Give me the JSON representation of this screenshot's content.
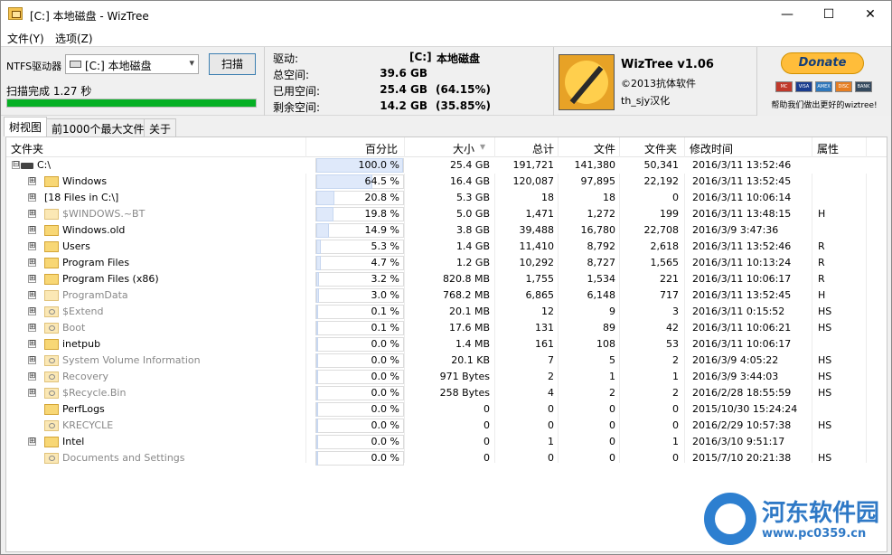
{
  "window": {
    "title": "[C:] 本地磁盘  - WizTree",
    "minimize": "—",
    "maximize": "☐",
    "close": "✕"
  },
  "menu": [
    "文件(Y)",
    "选项(Z)"
  ],
  "scan": {
    "drive_label": "NTFS驱动器",
    "drive_value": "[C:] 本地磁盘",
    "scan_button": "扫描",
    "status": "扫描完成 1.27 秒",
    "progress_percent": 100,
    "progress_color": "#06b025"
  },
  "drive_info": {
    "drive_label": "驱动:",
    "drive_letter": "[C:]",
    "drive_name": "本地磁盘",
    "total_label": "总空间:",
    "total_value": "39.6 GB",
    "used_label": "已用空间:",
    "used_value": "25.4 GB",
    "used_pct": "(64.15%)",
    "free_label": "剩余空间:",
    "free_value": "14.2 GB",
    "free_pct": "(35.85%)"
  },
  "about": {
    "name": "WizTree v1.06",
    "copyright": "©2013抗体软件",
    "translator": "th_sjy汉化",
    "donate": "Donate",
    "help_text": "帮助我们做出更好的wiztree!",
    "cards": [
      "MC",
      "VISA",
      "AMEX",
      "DISC",
      "BANK"
    ]
  },
  "tabs": [
    "树视图",
    "前1000个最大文件",
    "关于"
  ],
  "columns": [
    "文件夹",
    "百分比",
    "大小",
    "总计",
    "文件",
    "文件夹",
    "修改时间",
    "属性"
  ],
  "rows": [
    {
      "name": "C:\\",
      "pct": "100.0 %",
      "pct_value": 100.0,
      "size": "25.4 GB",
      "total": "191,721",
      "files": "141,380",
      "folders": "50,341",
      "modified": "2016/3/11 13:52:46",
      "attr": "",
      "icon": "drive-icon",
      "expander": "⊟",
      "gray": false
    },
    {
      "name": "Windows",
      "pct": "64.5 %",
      "pct_value": 64.5,
      "size": "16.4 GB",
      "total": "120,087",
      "files": "97,895",
      "folders": "22,192",
      "modified": "2016/3/11 13:52:45",
      "attr": "",
      "icon": "folder-icon",
      "expander": "⊞",
      "gray": false
    },
    {
      "name": "[18 Files in C:\\]",
      "pct": "20.8 %",
      "pct_value": 20.8,
      "size": "5.3 GB",
      "total": "18",
      "files": "18",
      "folders": "0",
      "modified": "2016/3/11 10:06:14",
      "attr": "",
      "icon": "",
      "expander": "⊞",
      "gray": false
    },
    {
      "name": "$WINDOWS.~BT",
      "pct": "19.8 %",
      "pct_value": 19.8,
      "size": "5.0 GB",
      "total": "1,471",
      "files": "1,272",
      "folders": "199",
      "modified": "2016/3/11 13:48:15",
      "attr": "H",
      "icon": "folder-icon",
      "expander": "⊞",
      "gray": true
    },
    {
      "name": "Windows.old",
      "pct": "14.9 %",
      "pct_value": 14.9,
      "size": "3.8 GB",
      "total": "39,488",
      "files": "16,780",
      "folders": "22,708",
      "modified": "2016/3/9 3:47:36",
      "attr": "",
      "icon": "folder-icon",
      "expander": "⊞",
      "gray": false
    },
    {
      "name": "Users",
      "pct": "5.3 %",
      "pct_value": 5.3,
      "size": "1.4 GB",
      "total": "11,410",
      "files": "8,792",
      "folders": "2,618",
      "modified": "2016/3/11 13:52:46",
      "attr": "R",
      "icon": "folder-icon",
      "expander": "⊞",
      "gray": false
    },
    {
      "name": "Program Files",
      "pct": "4.7 %",
      "pct_value": 4.7,
      "size": "1.2 GB",
      "total": "10,292",
      "files": "8,727",
      "folders": "1,565",
      "modified": "2016/3/11 10:13:24",
      "attr": "R",
      "icon": "folder-icon",
      "expander": "⊞",
      "gray": false
    },
    {
      "name": "Program Files (x86)",
      "pct": "3.2 %",
      "pct_value": 3.2,
      "size": "820.8 MB",
      "total": "1,755",
      "files": "1,534",
      "folders": "221",
      "modified": "2016/3/11 10:06:17",
      "attr": "R",
      "icon": "folder-icon",
      "expander": "⊞",
      "gray": false
    },
    {
      "name": "ProgramData",
      "pct": "3.0 %",
      "pct_value": 3.0,
      "size": "768.2 MB",
      "total": "6,865",
      "files": "6,148",
      "folders": "717",
      "modified": "2016/3/11 13:52:45",
      "attr": "H",
      "icon": "folder-icon",
      "expander": "⊞",
      "gray": true
    },
    {
      "name": "$Extend",
      "pct": "0.1 %",
      "pct_value": 0.1,
      "size": "20.1 MB",
      "total": "12",
      "files": "9",
      "folders": "3",
      "modified": "2016/3/11 0:15:52",
      "attr": "HS",
      "icon": "system-folder-icon",
      "expander": "⊞",
      "gray": true
    },
    {
      "name": "Boot",
      "pct": "0.1 %",
      "pct_value": 0.1,
      "size": "17.6 MB",
      "total": "131",
      "files": "89",
      "folders": "42",
      "modified": "2016/3/11 10:06:21",
      "attr": "HS",
      "icon": "system-folder-icon",
      "expander": "⊞",
      "gray": true
    },
    {
      "name": "inetpub",
      "pct": "0.0 %",
      "pct_value": 0.0,
      "size": "1.4 MB",
      "total": "161",
      "files": "108",
      "folders": "53",
      "modified": "2016/3/11 10:06:17",
      "attr": "",
      "icon": "folder-icon",
      "expander": "⊞",
      "gray": false
    },
    {
      "name": "System Volume Information",
      "pct": "0.0 %",
      "pct_value": 0.0,
      "size": "20.1 KB",
      "total": "7",
      "files": "5",
      "folders": "2",
      "modified": "2016/3/9 4:05:22",
      "attr": "HS",
      "icon": "system-folder-icon",
      "expander": "⊞",
      "gray": true
    },
    {
      "name": "Recovery",
      "pct": "0.0 %",
      "pct_value": 0.0,
      "size": "971 Bytes",
      "total": "2",
      "files": "1",
      "folders": "1",
      "modified": "2016/3/9 3:44:03",
      "attr": "HS",
      "icon": "system-folder-icon",
      "expander": "⊞",
      "gray": true
    },
    {
      "name": "$Recycle.Bin",
      "pct": "0.0 %",
      "pct_value": 0.0,
      "size": "258 Bytes",
      "total": "4",
      "files": "2",
      "folders": "2",
      "modified": "2016/2/28 18:55:59",
      "attr": "HS",
      "icon": "system-folder-icon",
      "expander": "⊞",
      "gray": true
    },
    {
      "name": "PerfLogs",
      "pct": "0.0 %",
      "pct_value": 0.0,
      "size": "0",
      "total": "0",
      "files": "0",
      "folders": "0",
      "modified": "2015/10/30 15:24:24",
      "attr": "",
      "icon": "folder-icon",
      "expander": "",
      "gray": false
    },
    {
      "name": "KRECYCLE",
      "pct": "0.0 %",
      "pct_value": 0.0,
      "size": "0",
      "total": "0",
      "files": "0",
      "folders": "0",
      "modified": "2016/2/29 10:57:38",
      "attr": "HS",
      "icon": "system-folder-icon",
      "expander": "",
      "gray": true
    },
    {
      "name": "Intel",
      "pct": "0.0 %",
      "pct_value": 0.0,
      "size": "0",
      "total": "1",
      "files": "0",
      "folders": "1",
      "modified": "2016/3/10 9:51:17",
      "attr": "",
      "icon": "folder-icon",
      "expander": "⊞",
      "gray": false
    },
    {
      "name": "Documents and Settings",
      "pct": "0.0 %",
      "pct_value": 0.0,
      "size": "0",
      "total": "0",
      "files": "0",
      "folders": "0",
      "modified": "2015/7/10 20:21:38",
      "attr": "HS",
      "icon": "system-folder-icon",
      "expander": "",
      "gray": true
    }
  ],
  "watermark": {
    "title": "河东软件园",
    "url": "www.pc0359.cn"
  }
}
